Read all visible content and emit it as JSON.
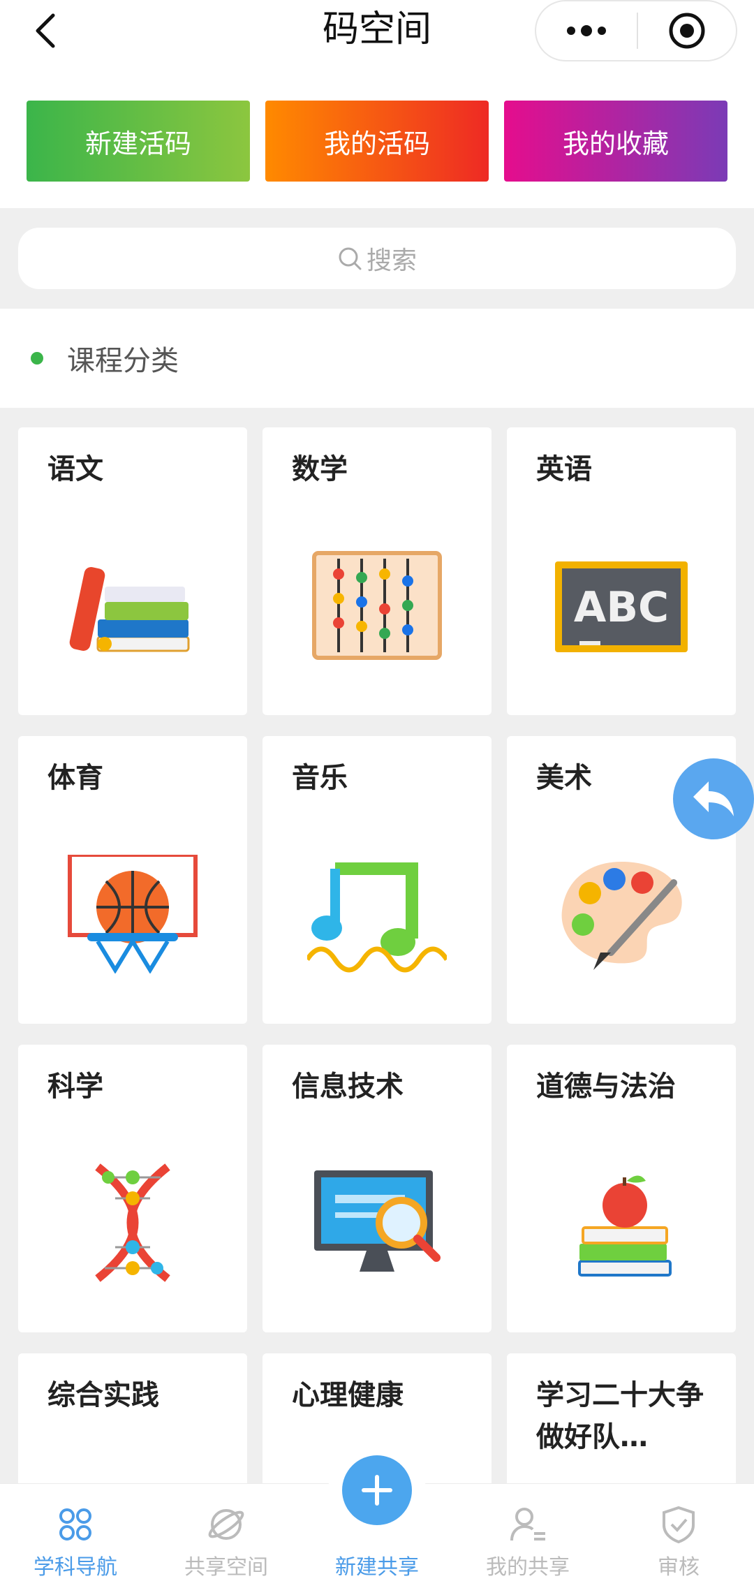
{
  "nav": {
    "title": "码空间"
  },
  "actions": {
    "new_code": "新建活码",
    "my_code": "我的活码",
    "my_favorites": "我的收藏"
  },
  "search": {
    "placeholder": "搜索"
  },
  "section": {
    "title": "课程分类"
  },
  "subjects": [
    {
      "label": "语文",
      "icon": "books-icon"
    },
    {
      "label": "数学",
      "icon": "abacus-icon"
    },
    {
      "label": "英语",
      "icon": "blackboard-abc-icon"
    },
    {
      "label": "体育",
      "icon": "basketball-hoop-icon"
    },
    {
      "label": "音乐",
      "icon": "music-note-icon"
    },
    {
      "label": "美术",
      "icon": "palette-icon"
    },
    {
      "label": "科学",
      "icon": "dna-icon"
    },
    {
      "label": "信息技术",
      "icon": "monitor-search-icon"
    },
    {
      "label": "道德与法治",
      "icon": "apple-books-icon"
    },
    {
      "label": "综合实践",
      "icon": ""
    },
    {
      "label": "心理健康",
      "icon": ""
    },
    {
      "label": "学习二十大争做好队…",
      "icon": ""
    }
  ],
  "tabs": [
    {
      "label": "学科导航",
      "icon": "grid-circles-icon",
      "active": true
    },
    {
      "label": "共享空间",
      "icon": "planet-icon",
      "active": false
    },
    {
      "label": "新建共享",
      "icon": "plus-icon",
      "active": false
    },
    {
      "label": "我的共享",
      "icon": "user-list-icon",
      "active": false
    },
    {
      "label": "审核",
      "icon": "shield-check-icon",
      "active": false
    }
  ],
  "colors": {
    "accent": "#4a9be8",
    "green": "#3bb54a"
  }
}
